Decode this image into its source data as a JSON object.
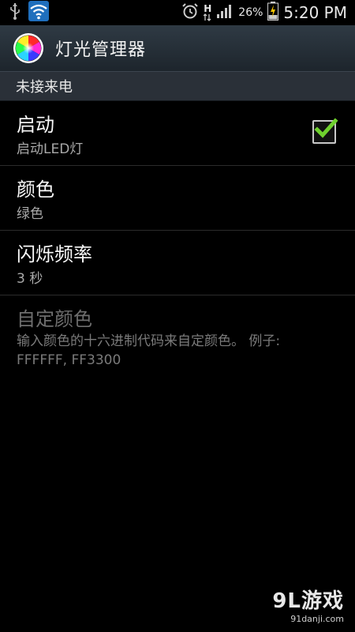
{
  "status_bar": {
    "time": "5:20 PM",
    "battery_percent": "26%",
    "network_type": "H",
    "icons": [
      "usb-icon",
      "wifi-icon",
      "alarm-icon",
      "data-arrows-icon",
      "signal-icon",
      "battery-charging-icon"
    ]
  },
  "action_bar": {
    "title": "灯光管理器",
    "icon": "rgb-color-wheel-icon"
  },
  "section": {
    "header": "未接来电"
  },
  "preferences": [
    {
      "title": "启动",
      "summary": "启动LED灯",
      "checked": true
    },
    {
      "title": "颜色",
      "summary": "绿色"
    },
    {
      "title": "闪烁频率",
      "summary": "3 秒"
    },
    {
      "title": "自定颜色",
      "summary": "输入颜色的十六进制代码来自定颜色。 例子: FFFFFF, FF3300",
      "enabled": false
    }
  ],
  "watermark": {
    "logo": "9L游戏",
    "url": "91danji.com"
  },
  "colors": {
    "checkmark": "#6fd12e",
    "action_bar": "#2a343d",
    "summary_text": "#a9a9a9"
  }
}
